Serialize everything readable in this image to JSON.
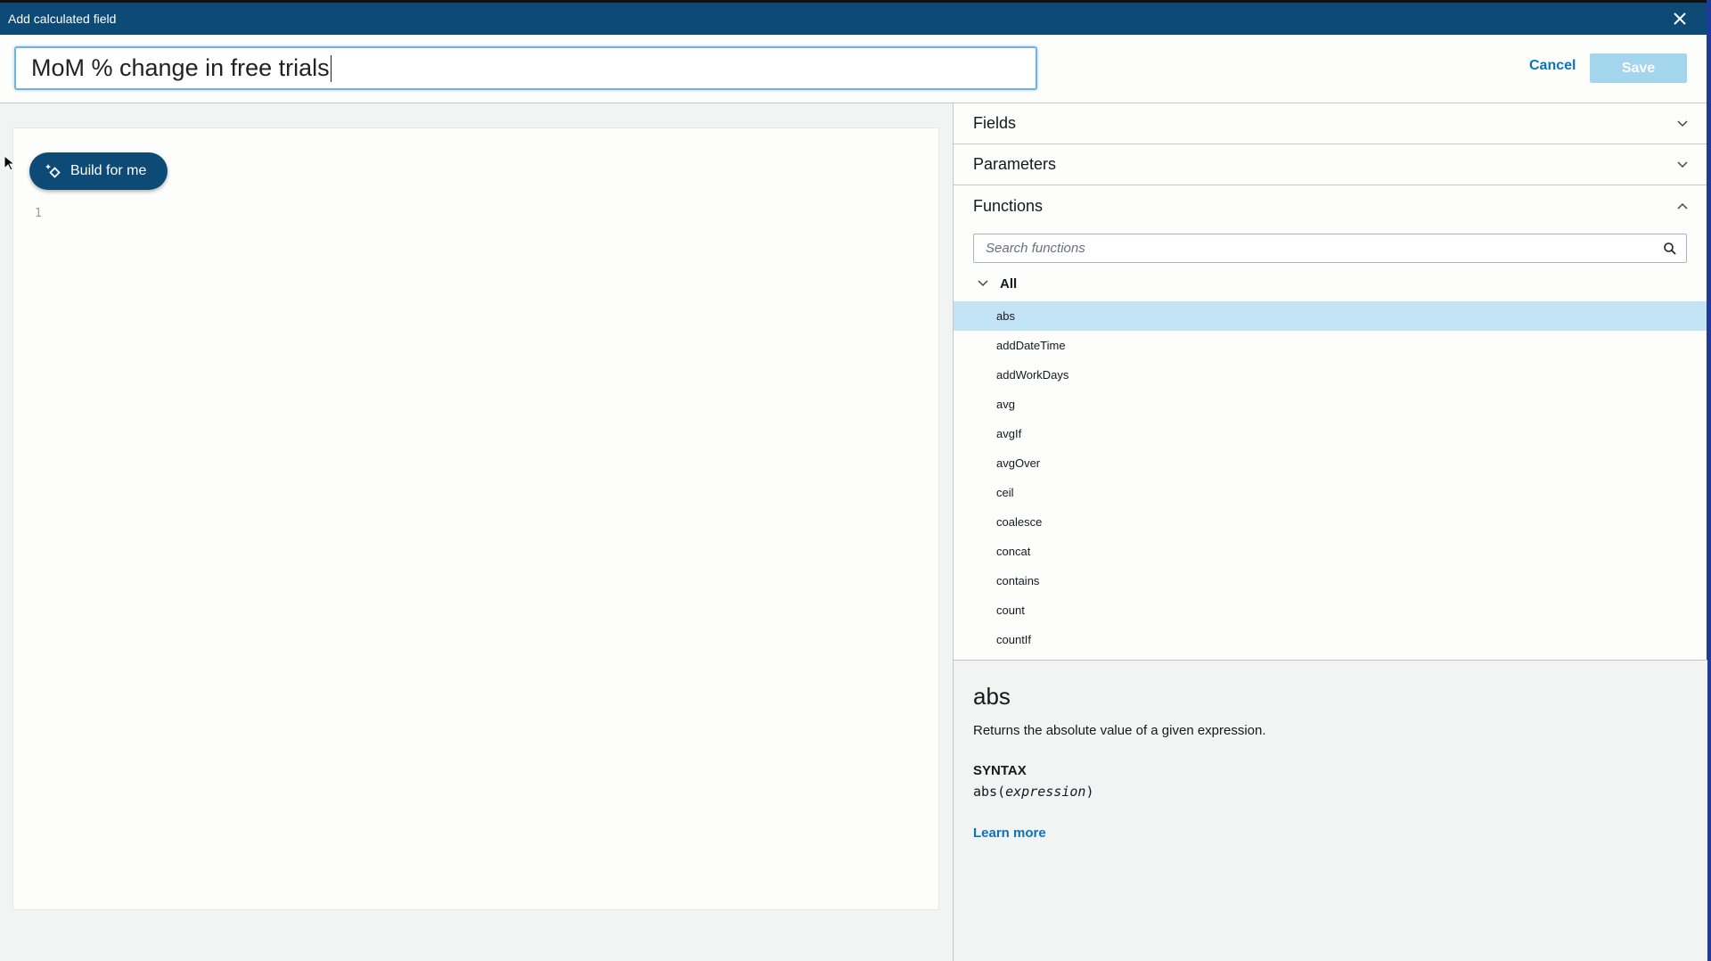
{
  "window": {
    "title": "Add calculated field"
  },
  "header": {
    "name_value": "MoM % change in free trials",
    "cancel_label": "Cancel",
    "save_label": "Save"
  },
  "editor": {
    "build_label": "Build for me",
    "line_number": "1"
  },
  "panel": {
    "sections": [
      {
        "label": "Fields"
      },
      {
        "label": "Parameters"
      },
      {
        "label": "Functions"
      }
    ],
    "search_placeholder": "Search functions",
    "group_label": "All",
    "functions": [
      "abs",
      "addDateTime",
      "addWorkDays",
      "avg",
      "avgIf",
      "avgOver",
      "ceil",
      "coalesce",
      "concat",
      "contains",
      "count",
      "countIf"
    ],
    "selected": "abs"
  },
  "description": {
    "title": "abs",
    "text": "Returns the absolute value of a given expression.",
    "syntax_label": "SYNTAX",
    "syntax_fn": "abs(",
    "syntax_arg": "expression",
    "syntax_close": ")",
    "learn_more": "Learn more"
  }
}
